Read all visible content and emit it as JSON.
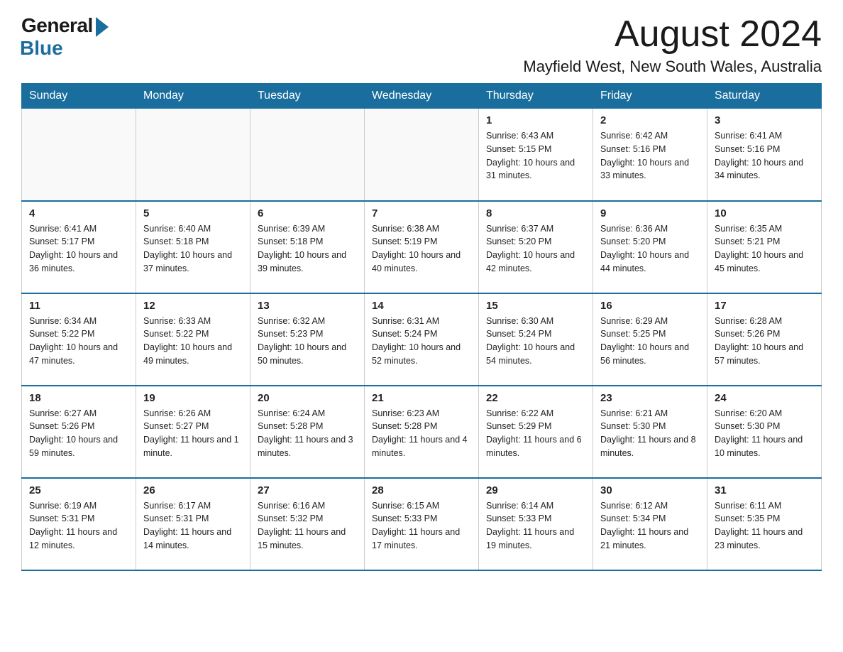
{
  "logo": {
    "general": "General",
    "blue": "Blue"
  },
  "header": {
    "month": "August 2024",
    "location": "Mayfield West, New South Wales, Australia"
  },
  "days_of_week": [
    "Sunday",
    "Monday",
    "Tuesday",
    "Wednesday",
    "Thursday",
    "Friday",
    "Saturday"
  ],
  "weeks": [
    [
      {
        "day": "",
        "info": ""
      },
      {
        "day": "",
        "info": ""
      },
      {
        "day": "",
        "info": ""
      },
      {
        "day": "",
        "info": ""
      },
      {
        "day": "1",
        "info": "Sunrise: 6:43 AM\nSunset: 5:15 PM\nDaylight: 10 hours and 31 minutes."
      },
      {
        "day": "2",
        "info": "Sunrise: 6:42 AM\nSunset: 5:16 PM\nDaylight: 10 hours and 33 minutes."
      },
      {
        "day": "3",
        "info": "Sunrise: 6:41 AM\nSunset: 5:16 PM\nDaylight: 10 hours and 34 minutes."
      }
    ],
    [
      {
        "day": "4",
        "info": "Sunrise: 6:41 AM\nSunset: 5:17 PM\nDaylight: 10 hours and 36 minutes."
      },
      {
        "day": "5",
        "info": "Sunrise: 6:40 AM\nSunset: 5:18 PM\nDaylight: 10 hours and 37 minutes."
      },
      {
        "day": "6",
        "info": "Sunrise: 6:39 AM\nSunset: 5:18 PM\nDaylight: 10 hours and 39 minutes."
      },
      {
        "day": "7",
        "info": "Sunrise: 6:38 AM\nSunset: 5:19 PM\nDaylight: 10 hours and 40 minutes."
      },
      {
        "day": "8",
        "info": "Sunrise: 6:37 AM\nSunset: 5:20 PM\nDaylight: 10 hours and 42 minutes."
      },
      {
        "day": "9",
        "info": "Sunrise: 6:36 AM\nSunset: 5:20 PM\nDaylight: 10 hours and 44 minutes."
      },
      {
        "day": "10",
        "info": "Sunrise: 6:35 AM\nSunset: 5:21 PM\nDaylight: 10 hours and 45 minutes."
      }
    ],
    [
      {
        "day": "11",
        "info": "Sunrise: 6:34 AM\nSunset: 5:22 PM\nDaylight: 10 hours and 47 minutes."
      },
      {
        "day": "12",
        "info": "Sunrise: 6:33 AM\nSunset: 5:22 PM\nDaylight: 10 hours and 49 minutes."
      },
      {
        "day": "13",
        "info": "Sunrise: 6:32 AM\nSunset: 5:23 PM\nDaylight: 10 hours and 50 minutes."
      },
      {
        "day": "14",
        "info": "Sunrise: 6:31 AM\nSunset: 5:24 PM\nDaylight: 10 hours and 52 minutes."
      },
      {
        "day": "15",
        "info": "Sunrise: 6:30 AM\nSunset: 5:24 PM\nDaylight: 10 hours and 54 minutes."
      },
      {
        "day": "16",
        "info": "Sunrise: 6:29 AM\nSunset: 5:25 PM\nDaylight: 10 hours and 56 minutes."
      },
      {
        "day": "17",
        "info": "Sunrise: 6:28 AM\nSunset: 5:26 PM\nDaylight: 10 hours and 57 minutes."
      }
    ],
    [
      {
        "day": "18",
        "info": "Sunrise: 6:27 AM\nSunset: 5:26 PM\nDaylight: 10 hours and 59 minutes."
      },
      {
        "day": "19",
        "info": "Sunrise: 6:26 AM\nSunset: 5:27 PM\nDaylight: 11 hours and 1 minute."
      },
      {
        "day": "20",
        "info": "Sunrise: 6:24 AM\nSunset: 5:28 PM\nDaylight: 11 hours and 3 minutes."
      },
      {
        "day": "21",
        "info": "Sunrise: 6:23 AM\nSunset: 5:28 PM\nDaylight: 11 hours and 4 minutes."
      },
      {
        "day": "22",
        "info": "Sunrise: 6:22 AM\nSunset: 5:29 PM\nDaylight: 11 hours and 6 minutes."
      },
      {
        "day": "23",
        "info": "Sunrise: 6:21 AM\nSunset: 5:30 PM\nDaylight: 11 hours and 8 minutes."
      },
      {
        "day": "24",
        "info": "Sunrise: 6:20 AM\nSunset: 5:30 PM\nDaylight: 11 hours and 10 minutes."
      }
    ],
    [
      {
        "day": "25",
        "info": "Sunrise: 6:19 AM\nSunset: 5:31 PM\nDaylight: 11 hours and 12 minutes."
      },
      {
        "day": "26",
        "info": "Sunrise: 6:17 AM\nSunset: 5:31 PM\nDaylight: 11 hours and 14 minutes."
      },
      {
        "day": "27",
        "info": "Sunrise: 6:16 AM\nSunset: 5:32 PM\nDaylight: 11 hours and 15 minutes."
      },
      {
        "day": "28",
        "info": "Sunrise: 6:15 AM\nSunset: 5:33 PM\nDaylight: 11 hours and 17 minutes."
      },
      {
        "day": "29",
        "info": "Sunrise: 6:14 AM\nSunset: 5:33 PM\nDaylight: 11 hours and 19 minutes."
      },
      {
        "day": "30",
        "info": "Sunrise: 6:12 AM\nSunset: 5:34 PM\nDaylight: 11 hours and 21 minutes."
      },
      {
        "day": "31",
        "info": "Sunrise: 6:11 AM\nSunset: 5:35 PM\nDaylight: 11 hours and 23 minutes."
      }
    ]
  ]
}
